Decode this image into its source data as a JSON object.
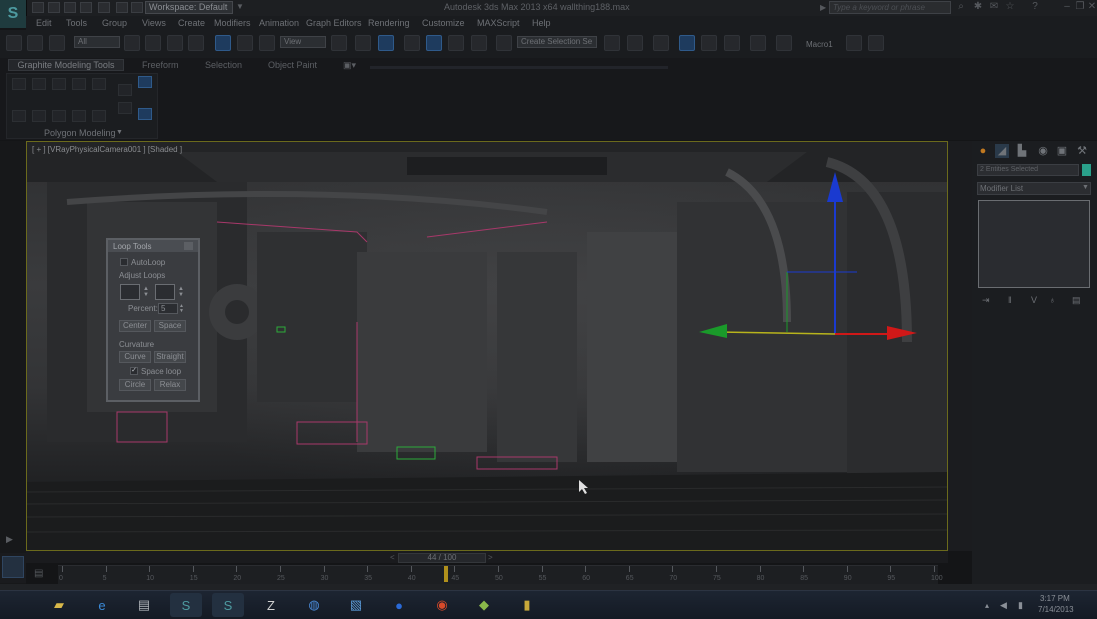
{
  "title_bar": {
    "workspace_label": "Workspace: Default",
    "app_title": "Autodesk 3ds Max  2013 x64     wallthing188.max",
    "search_placeholder": "Type a keyword or phrase"
  },
  "menu": [
    "Edit",
    "Tools",
    "Group",
    "Views",
    "Create",
    "Modifiers",
    "Animation",
    "Graph Editors",
    "Rendering",
    "Customize",
    "MAXScript",
    "Help"
  ],
  "toolbar": {
    "filter_value": "All",
    "ref_coord_value": "View",
    "selection_set_value": "Create Selection Se",
    "macro_label": "Macro1"
  },
  "ribbon": {
    "tabs": [
      "Graphite Modeling Tools",
      "Freeform",
      "Selection",
      "Object Paint"
    ],
    "panel_label": "Polygon Modeling"
  },
  "viewport": {
    "label": "[ + ] [VRayPhysicalCamera001 ] [Shaded ]"
  },
  "loop_tools": {
    "title": "Loop Tools",
    "autoloop": "AutoLoop",
    "adjust_loops": "Adjust Loops",
    "percent_label": "Percent:",
    "percent_value": "5",
    "center": "Center",
    "space": "Space",
    "curvature": "Curvature",
    "curve": "Curve",
    "straight": "Straight",
    "space_loop": "Space loop",
    "circle": "Circle",
    "relax": "Relax"
  },
  "command_panel": {
    "selection_info": "2 Entities Selected",
    "modifier_list": "Modifier List"
  },
  "timeline": {
    "frame_display": "44 / 100",
    "ticks": [
      "0",
      "5",
      "10",
      "15",
      "20",
      "25",
      "30",
      "35",
      "40",
      "45",
      "50",
      "55",
      "60",
      "65",
      "70",
      "75",
      "80",
      "85",
      "90",
      "95",
      "100"
    ]
  },
  "taskbar": {
    "time": "3:17 PM",
    "date": "7/14/2013"
  },
  "colors": {
    "viewport_border": "#6b6a1c",
    "active_blue": "#2f5a8a",
    "gizmo_red": "#d01818",
    "gizmo_green": "#1a9a2a",
    "gizmo_blue": "#1a3ad0"
  }
}
